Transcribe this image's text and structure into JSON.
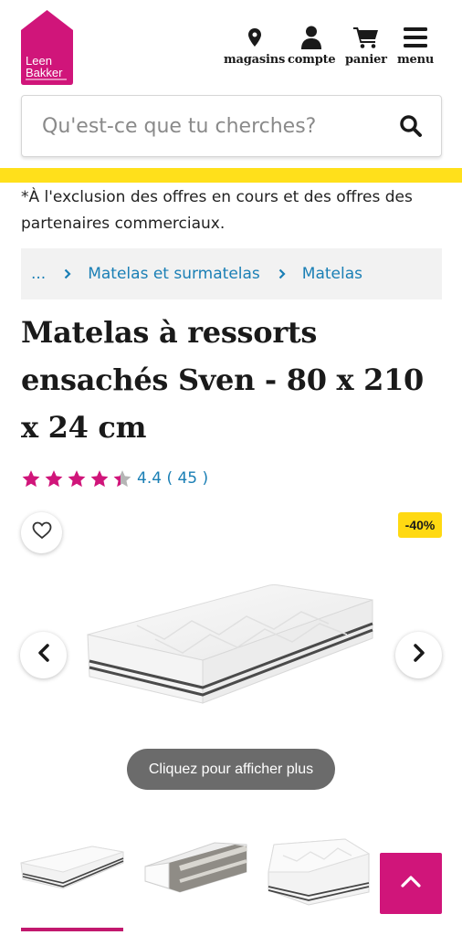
{
  "brand": {
    "line1": "Leen",
    "line2": "Bakker",
    "color": "#d0157a"
  },
  "nav": [
    {
      "label": "magasins",
      "icon": "map-pin-icon"
    },
    {
      "label": "compte",
      "icon": "user-icon"
    },
    {
      "label": "panier",
      "icon": "cart-icon"
    },
    {
      "label": "menu",
      "icon": "hamburger-icon"
    }
  ],
  "search": {
    "placeholder": "Qu'est-ce que tu cherches?",
    "value": ""
  },
  "disclaimer": "*À l'exclusion des offres en cours et des offres des partenaires commerciaux.",
  "breadcrumb": {
    "ellipsis": "...",
    "items": [
      "Matelas et surmatelas",
      "Matelas"
    ]
  },
  "product": {
    "title": "Matelas à ressorts ensachés Sven - 80 x 210 x 24 cm",
    "rating": {
      "value": "4.4",
      "count": "( 45 )",
      "stars": 4.4,
      "max": 5
    },
    "discount_badge": "-40%",
    "show_more": "Cliquez pour afficher plus"
  },
  "colors": {
    "accent": "#d0157a",
    "link": "#1a7fb5",
    "badge": "#ffd912",
    "banner": "#ffe01b"
  }
}
